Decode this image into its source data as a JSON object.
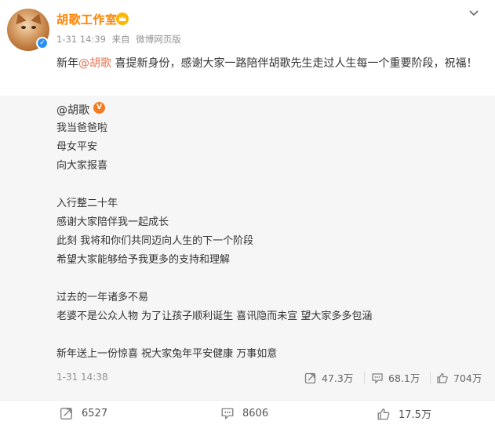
{
  "header": {
    "username": "胡歌工作室",
    "time": "1-31 14:39",
    "source_prefix": "来自",
    "source": "微博网页版"
  },
  "post": {
    "text_before": "新年",
    "mention": "@胡歌",
    "text_after": " 喜提新身份，感谢大家一路陪伴胡歌先生走过人生每一个重要阶段，祝福！"
  },
  "retweet": {
    "author": "@胡歌",
    "lines": [
      "我当爸爸啦",
      "母女平安",
      "向大家报喜",
      "",
      "入行整二十年",
      "感谢大家陪伴我一起成长",
      "此刻 我将和你们共同迈向人生的下一个阶段",
      "希望大家能够给予我更多的支持和理解",
      "",
      "过去的一年诸多不易",
      "老婆不是公众人物 为了让孩子顺利诞生 喜讯隐而未宣 望大家多多包涵",
      "",
      "新年送上一份惊喜 祝大家兔年平安健康 万事如意"
    ],
    "time": "1-31 14:38",
    "reposts": "47.3万",
    "comments": "68.1万",
    "likes": "704万"
  },
  "actions": {
    "reposts": "6527",
    "comments": "8606",
    "likes": "17.5万"
  },
  "icons": {
    "crown": "crown-icon",
    "chevron": "chevron-down-icon",
    "repost": "repost-icon",
    "comment": "comment-icon",
    "like": "thumbs-up-icon"
  },
  "colors": {
    "username": "#ff8200",
    "mention": "#eb7350",
    "retweet_bg": "#f6f6f6",
    "meta": "#939393"
  }
}
